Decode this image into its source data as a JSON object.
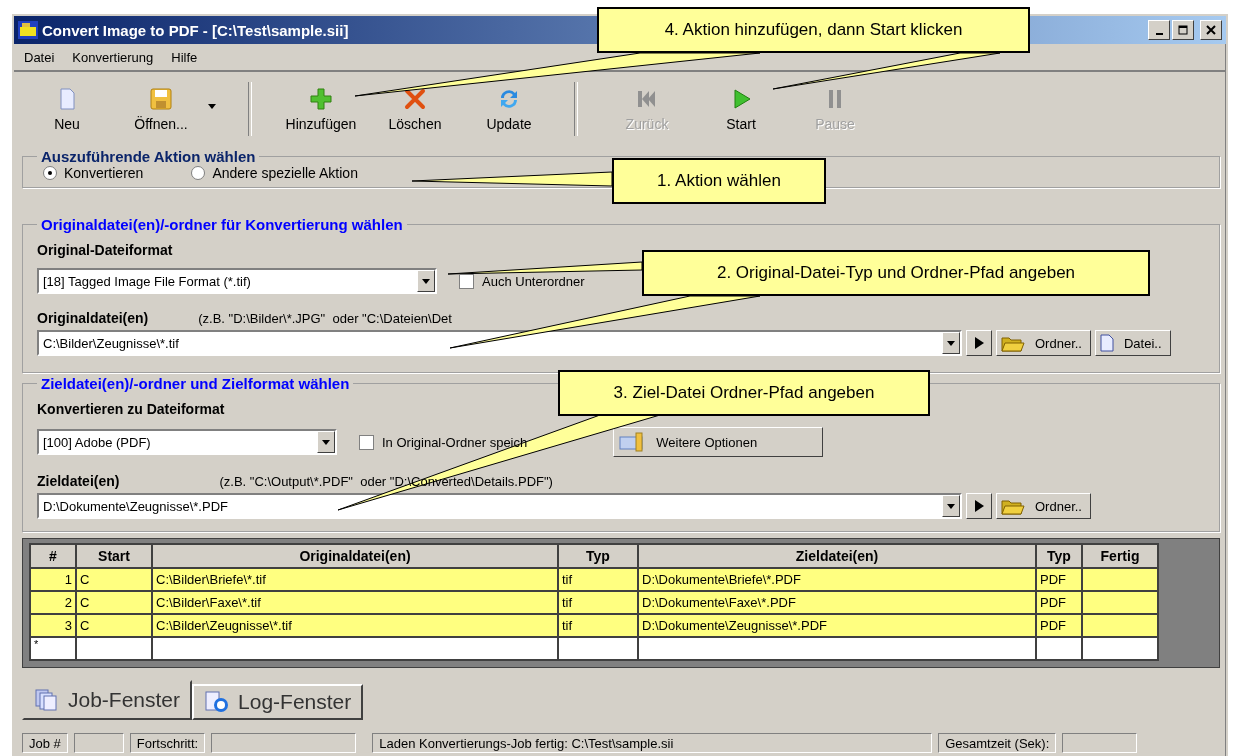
{
  "window": {
    "title": "Convert Image to PDF - [C:\\Test\\sample.sii]"
  },
  "menu": [
    "Datei",
    "Konvertierung",
    "Hilfe"
  ],
  "toolbar": [
    [
      {
        "label": "Neu",
        "kind": "new",
        "disabled": false
      },
      {
        "label": "Öffnen...",
        "kind": "open",
        "disabled": false,
        "dropdown": true
      }
    ],
    [
      {
        "label": "Hinzufügen",
        "kind": "add",
        "disabled": false
      },
      {
        "label": "Löschen",
        "kind": "delete",
        "disabled": false
      },
      {
        "label": "Update",
        "kind": "refresh",
        "disabled": false
      }
    ],
    [
      {
        "label": "Zurück",
        "kind": "rewind",
        "disabled": true
      },
      {
        "label": "Start",
        "kind": "play",
        "disabled": false
      },
      {
        "label": "Pause",
        "kind": "pause",
        "disabled": true
      }
    ]
  ],
  "action_group": {
    "title": "Auszuführende Aktion wählen",
    "options": [
      {
        "label": "Konvertieren",
        "selected": true
      },
      {
        "label": "Andere spezielle Aktion",
        "selected": false
      }
    ]
  },
  "source_group": {
    "title": "Originaldatei(en)/-ordner für Konvertierung wählen",
    "format_label": "Original-Dateiformat",
    "format_value": "[18] Tagged Image File Format (*.tif)",
    "subfolders": {
      "label": "Auch Unterordner",
      "checked": false
    },
    "files_label": "Originaldatei(en)",
    "files_hint": "(z.B. \"D:\\Bilder\\*.JPG\"  oder \"C:\\Dateien\\Det",
    "files_value": "C:\\Bilder\\Zeugnisse\\*.tif",
    "folder_button": "Ordner..",
    "file_button": "Datei.."
  },
  "target_group": {
    "title": "Zieldatei(en)/-ordner und Zielformat wählen",
    "format_label": "Konvertieren zu Dateiformat",
    "format_value": "[100] Adobe (PDF)",
    "keep_folder": {
      "label": "In Original-Ordner speich",
      "checked": false
    },
    "options_button": "Weitere Optionen",
    "files_label": "Zieldatei(en)",
    "files_hint": "(z.B. \"C:\\Output\\*.PDF\"  oder \"D:\\Converted\\Details.PDF\")",
    "files_value": "D:\\Dokumente\\Zeugnisse\\*.PDF",
    "folder_button": "Ordner.."
  },
  "jobs_table": {
    "columns": [
      "#",
      "Start",
      "Originaldatei(en)",
      "Typ",
      "Zieldatei(en)",
      "Typ",
      "Fertig"
    ],
    "rows": [
      {
        "num": "1",
        "start": "C",
        "source": "C:\\Bilder\\Briefe\\*.tif",
        "source_type": "tif",
        "target": "D:\\Dokumente\\Briefe\\*.PDF",
        "target_type": "PDF"
      },
      {
        "num": "2",
        "start": "C",
        "source": "C:\\Bilder\\Faxe\\*.tif",
        "source_type": "tif",
        "target": "D:\\Dokumente\\Faxe\\*.PDF",
        "target_type": "PDF"
      },
      {
        "num": "3",
        "start": "C",
        "source": "C:\\Bilder\\Zeugnisse\\*.tif",
        "source_type": "tif",
        "target": "D:\\Dokumente\\Zeugnisse\\*.PDF",
        "target_type": "PDF"
      }
    ],
    "new_row_marker": "*"
  },
  "tabs": [
    {
      "label": "Job-Fenster",
      "kind": "jobs",
      "selected": true
    },
    {
      "label": "Log-Fenster",
      "kind": "log",
      "selected": false
    }
  ],
  "status_bar": {
    "job_label": "Job #",
    "progress_label": "Fortschritt:",
    "message": "Laden Konvertierungs-Job fertig: C:\\Test\\sample.sii",
    "time_label": "Gesamtzeit (Sek):"
  },
  "callouts": [
    {
      "text": "4. Aktion hinzufügen, dann Start klicken"
    },
    {
      "text": "1. Aktion wählen"
    },
    {
      "text": "2. Original-Datei-Typ und Ordner-Pfad angeben"
    },
    {
      "text": "3. Ziel-Datei Ordner-Pfad angeben"
    }
  ]
}
